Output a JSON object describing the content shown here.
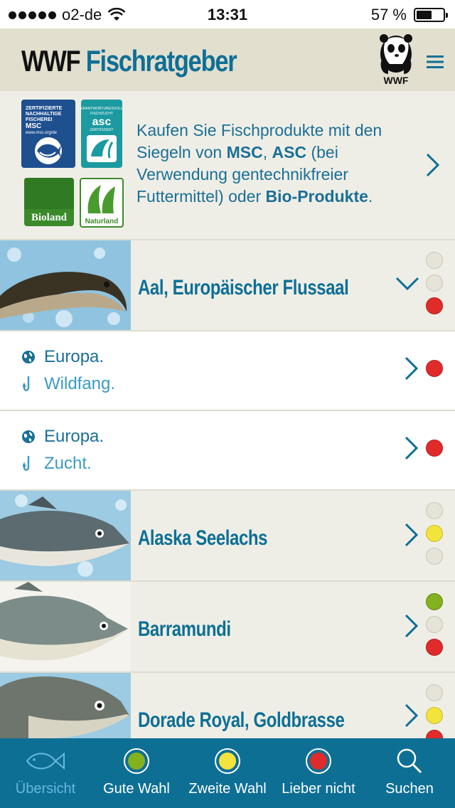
{
  "status_bar": {
    "carrier": "o2-de",
    "time": "13:31",
    "battery": "57 %",
    "battery_level": 0.57
  },
  "header": {
    "title_part1": "WWF",
    "title_part2": "Fischratgeber",
    "logo_text": "WWF"
  },
  "banner": {
    "logos": {
      "msc_text": "ZERTIFIZIERTE NACHHALTIGE FISCHEREI MSC www.msc.org/de",
      "asc_text": "asc",
      "bioland_text": "Bioland",
      "naturland_text": "Naturland"
    },
    "text_1": "Kaufen Sie Fischprodukte mit den Siegeln von ",
    "msc": "MSC",
    "text_2": ", ",
    "asc": "ASC",
    "text_3": " (bei Verwendung gentechnikfreier Futtermittel) oder ",
    "bio": "Bio-Produkte",
    "text_4": "."
  },
  "fish": [
    {
      "name": "Aal, Europäischer Flussaal",
      "rating": [
        "off",
        "off",
        "red"
      ],
      "expanded": true
    },
    {
      "name": "Alaska Seelachs",
      "rating": [
        "off",
        "yellow",
        "off"
      ],
      "expanded": false
    },
    {
      "name": "Barramundi",
      "rating": [
        "green",
        "off",
        "red"
      ],
      "expanded": false
    },
    {
      "name": "Dorade Royal, Goldbrasse",
      "rating": [
        "off",
        "yellow",
        "red"
      ],
      "expanded": false
    }
  ],
  "origins": [
    {
      "region": "Europa.",
      "method": "Wildfang.",
      "rating": "red"
    },
    {
      "region": "Europa.",
      "method": "Zucht.",
      "rating": "red"
    }
  ],
  "tabs": [
    {
      "label": "Übersicht",
      "icon": "fish-icon",
      "active": true
    },
    {
      "label": "Gute Wahl",
      "icon": "green-dot-icon",
      "color": "#84b21e"
    },
    {
      "label": "Zweite Wahl",
      "icon": "yellow-dot-icon",
      "color": "#f3e33d"
    },
    {
      "label": "Lieber nicht",
      "icon": "red-dot-icon",
      "color": "#e02b2b"
    },
    {
      "label": "Suchen",
      "icon": "search-icon"
    }
  ]
}
